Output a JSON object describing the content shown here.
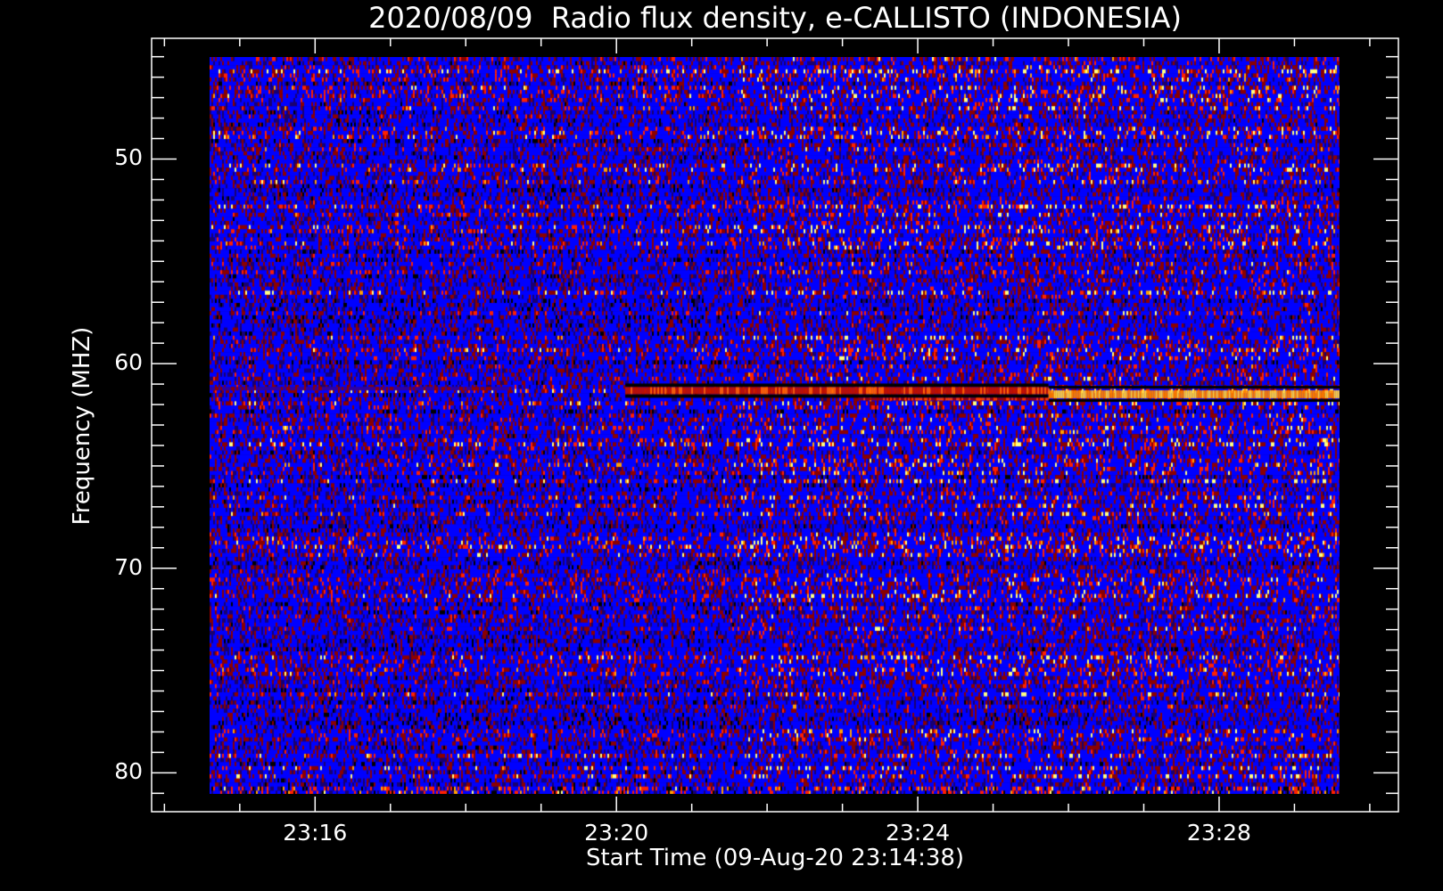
{
  "chart_data": {
    "type": "heatmap",
    "title": "2020/08/09  Radio flux density, e-CALLISTO (INDONESIA)",
    "xlabel": "Start Time (09-Aug-20 23:14:38)",
    "ylabel": "Frequency (MHZ)",
    "x_units": "minutes after 23:00 UT",
    "xlim": [
      13.83,
      30.38
    ],
    "ylim": [
      81.9,
      44.1
    ],
    "data_extent": {
      "x": [
        15.0,
        29.95
      ],
      "y": [
        45.0,
        81.0
      ]
    },
    "x_major_ticks": [
      16,
      20,
      24,
      28
    ],
    "x_tick_labels": [
      "23:16",
      "23:20",
      "23:24",
      "23:28"
    ],
    "x_minor_step": 1,
    "y_major_ticks": [
      50,
      60,
      70,
      80
    ],
    "y_tick_labels": [
      "50",
      "60",
      "70",
      "80"
    ],
    "y_minor_step": 1,
    "colormap": [
      "#000000",
      "#1a0070",
      "#0000ff",
      "#8b0000",
      "#ff2000",
      "#ffa000",
      "#ffff80"
    ],
    "features": [
      {
        "name": "narrowband interference",
        "freq_mhz": 61.3,
        "start_min": 20.5,
        "end_min": 26.1,
        "intensity": "moderate (red, bordered by dark lines)"
      },
      {
        "name": "narrowband interference",
        "freq_mhz": 61.5,
        "start_min": 26.1,
        "end_min": 29.95,
        "intensity": "high (yellow)"
      },
      {
        "name": "weak band",
        "freq_mhz": 61.2,
        "start_min": 15.0,
        "end_min": 19.0,
        "intensity": "low"
      },
      {
        "name": "bottom channel",
        "freq_mhz": 81.0,
        "start_min": 15.0,
        "end_min": 29.95,
        "intensity": "intermittent red/orange"
      }
    ],
    "grid": false
  }
}
